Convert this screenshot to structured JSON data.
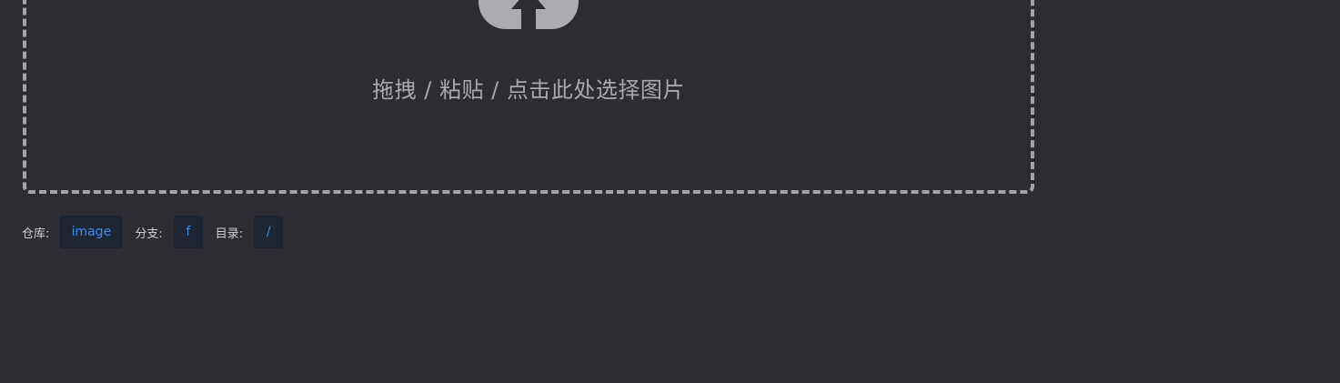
{
  "upload": {
    "icon": "upload-cloud-icon",
    "hint": "拖拽 / 粘贴 / 点击此处选择图片"
  },
  "settings": {
    "repo_label": "仓库:",
    "repo_value": "image",
    "branch_label": "分支:",
    "branch_value": "f",
    "dir_label": "目录:",
    "dir_value": "/"
  },
  "colors": {
    "background": "#2c2c32",
    "dashed_border": "#a3a3a8",
    "icon": "#ababb0",
    "tag_background": "#1f2633",
    "tag_text": "#3d8ce8"
  }
}
